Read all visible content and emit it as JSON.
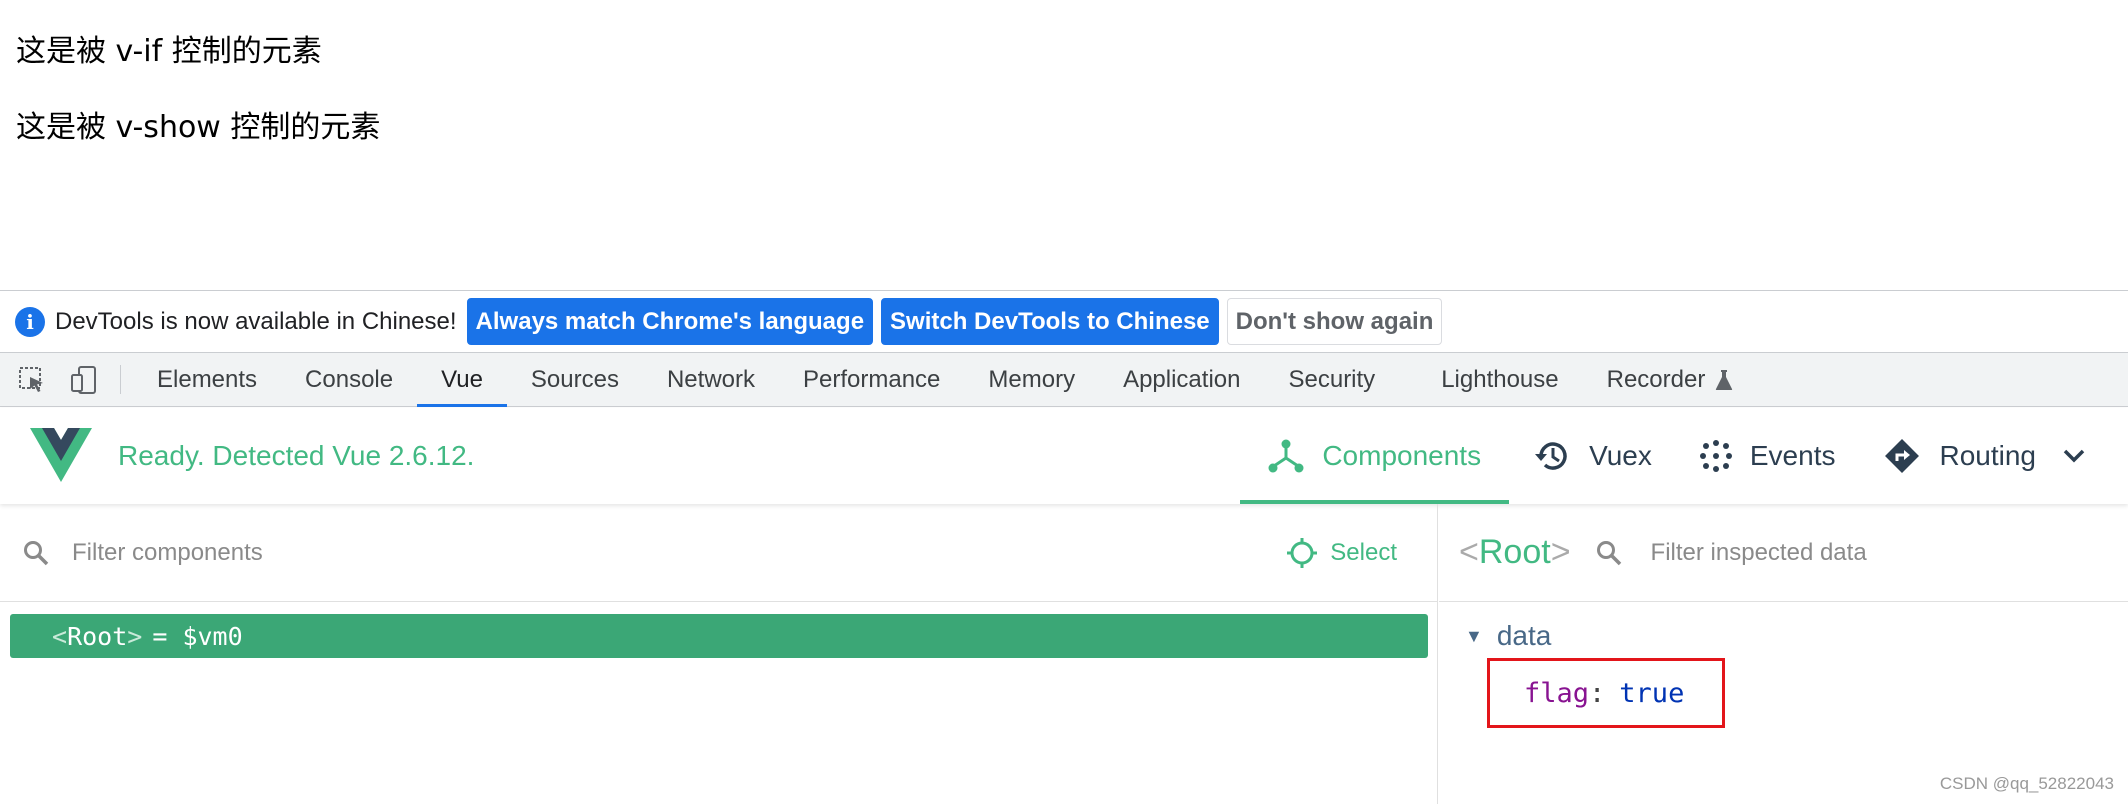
{
  "page": {
    "line1": "这是被 v-if 控制的元素",
    "line2": "这是被 v-show 控制的元素"
  },
  "infobar": {
    "icon": "info-icon",
    "message": "DevTools is now available in Chinese!",
    "btn_match": "Always match Chrome's language",
    "btn_switch": "Switch DevTools to Chinese",
    "btn_dismiss": "Don't show again"
  },
  "devtools": {
    "tabs": [
      "Elements",
      "Console",
      "Vue",
      "Sources",
      "Network",
      "Performance",
      "Memory",
      "Application",
      "Security",
      "Lighthouse",
      "Recorder"
    ],
    "active_tab": "Vue"
  },
  "vue": {
    "status": "Ready. Detected Vue 2.6.12.",
    "nav": {
      "components": "Components",
      "vuex": "Vuex",
      "events": "Events",
      "routing": "Routing"
    },
    "active_nav": "Components",
    "accent_color": "#42b983"
  },
  "components_panel": {
    "filter_placeholder": "Filter components",
    "select_label": "Select",
    "tree": [
      {
        "open": "<",
        "name": "Root",
        "close": ">",
        "ref": "= $vm0",
        "selected": true
      }
    ]
  },
  "inspector": {
    "root_open": "<",
    "root_name": "Root",
    "root_close": ">",
    "filter_placeholder": "Filter inspected data",
    "section": "data",
    "props": [
      {
        "key": "flag",
        "value": "true"
      }
    ],
    "highlight_color": "#e3151a"
  },
  "watermark": "CSDN @qq_52822043"
}
